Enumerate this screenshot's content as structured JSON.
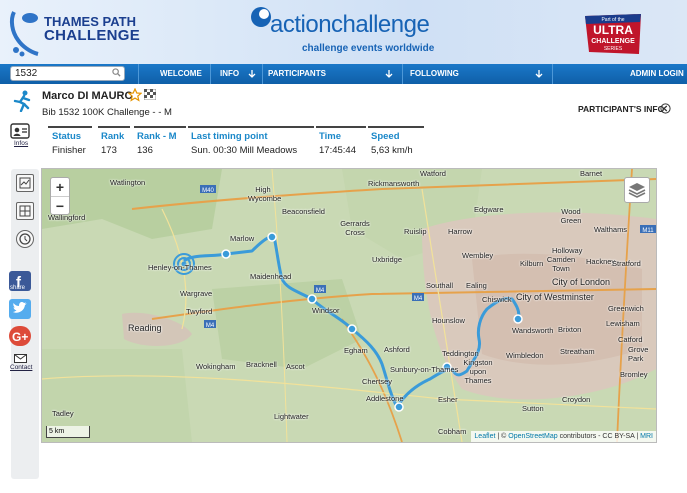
{
  "header": {
    "tp_logo_line1": "THAMES PATH",
    "tp_logo_line2": "CHALLENGE",
    "ac_title": "actionchallenge",
    "ac_subtitle": "challenge events worldwide",
    "ultra_line1": "Part of the",
    "ultra_line2": "ULTRA",
    "ultra_line3": "CHALLENGE",
    "ultra_line4": "SERIES"
  },
  "nav": {
    "search_value": "1532",
    "items": [
      "WELCOME",
      "INFO",
      "PARTICIPANTS",
      "FOLLOWING",
      "ADMIN LOGIN"
    ]
  },
  "participant": {
    "name": "Marco DI MAURO",
    "bib_line": "Bib 1532   100K Challenge - - M",
    "info_link": "PARTICIPANT'S INFO"
  },
  "rail": {
    "infos_label": "Infos",
    "share_label": "share",
    "contact_label": "Contact"
  },
  "stats": {
    "headers": [
      "Status",
      "Rank",
      "Rank - M",
      "Last timing point",
      "Time",
      "Speed"
    ],
    "values": [
      "Finisher",
      "173",
      "136",
      "Sun. 00:30   Mill Meadows",
      "17:45:44",
      "5,63 km/h"
    ]
  },
  "map": {
    "scale": "5 km",
    "attribution_leaflet": "Leaflet",
    "attribution_sep": " | © ",
    "attribution_osm": "OpenStreetMap",
    "attribution_rest": " contributors - CC BY-SA | ",
    "attribution_mri": "MRI",
    "places": [
      {
        "name": "Watlington"
      },
      {
        "name": "High Wycombe"
      },
      {
        "name": "Rickmansworth"
      },
      {
        "name": "Watford"
      },
      {
        "name": "Barnet"
      },
      {
        "name": "Beaconsfield"
      },
      {
        "name": "Gerrards Cross"
      },
      {
        "name": "Ruislip"
      },
      {
        "name": "Harrow"
      },
      {
        "name": "Edgware"
      },
      {
        "name": "Wood Green"
      },
      {
        "name": "Walthams"
      },
      {
        "name": "Wallingford"
      },
      {
        "name": "Marlow"
      },
      {
        "name": "Wembley"
      },
      {
        "name": "Kilburn"
      },
      {
        "name": "Holloway"
      },
      {
        "name": "Camden Town"
      },
      {
        "name": "Hackney"
      },
      {
        "name": "Stratford"
      },
      {
        "name": "Henley-on-Thames"
      },
      {
        "name": "Maidenhead"
      },
      {
        "name": "Uxbridge"
      },
      {
        "name": "City of London"
      },
      {
        "name": "Wargrave"
      },
      {
        "name": "Twyford"
      },
      {
        "name": "Southall"
      },
      {
        "name": "Ealing"
      },
      {
        "name": "Chiswick"
      },
      {
        "name": "City of Westminster"
      },
      {
        "name": "Greenwich"
      },
      {
        "name": "Reading"
      },
      {
        "name": "Windsor"
      },
      {
        "name": "Hounslow"
      },
      {
        "name": "Wandsworth"
      },
      {
        "name": "Brixton"
      },
      {
        "name": "Lewisham"
      },
      {
        "name": "Catford"
      },
      {
        "name": "Egham"
      },
      {
        "name": "Ashford"
      },
      {
        "name": "Wimbledon"
      },
      {
        "name": "Streatham"
      },
      {
        "name": "Grove Park"
      },
      {
        "name": "Wokingham"
      },
      {
        "name": "Bracknell"
      },
      {
        "name": "Ascot"
      },
      {
        "name": "Teddington"
      },
      {
        "name": "Kingston upon Thames"
      },
      {
        "name": "Sunbury-on-Thames"
      },
      {
        "name": "Bromley"
      },
      {
        "name": "Chertsey"
      },
      {
        "name": "Addlestone"
      },
      {
        "name": "Esher"
      },
      {
        "name": "Sutton"
      },
      {
        "name": "Croydon"
      },
      {
        "name": "Tadley"
      },
      {
        "name": "Lightwater"
      },
      {
        "name": "Cobham"
      }
    ]
  },
  "colors": {
    "accent": "#1b88c9",
    "route": "#3a9bd9",
    "nav": "#1570bd"
  }
}
